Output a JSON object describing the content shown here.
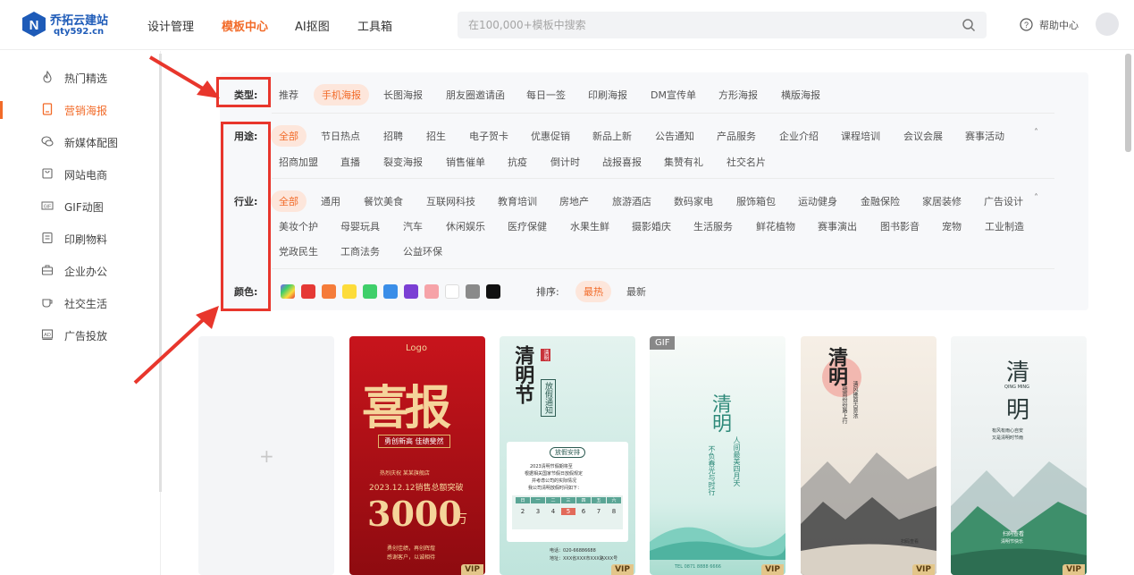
{
  "logo": {
    "name": "乔拓云建站",
    "domain": "qty592.cn"
  },
  "nav": [
    {
      "label": "设计管理",
      "active": false
    },
    {
      "label": "模板中心",
      "active": true
    },
    {
      "label": "AI抠图",
      "active": false
    },
    {
      "label": "工具箱",
      "active": false
    }
  ],
  "search": {
    "placeholder": "在100,000+模板中搜索",
    "icon": "search-icon"
  },
  "help": {
    "label": "帮助中心",
    "icon": "question-icon"
  },
  "sidebar": {
    "items": [
      {
        "label": "热门精选",
        "icon": "flame-icon",
        "active": false
      },
      {
        "label": "营销海报",
        "icon": "poster-icon",
        "active": true
      },
      {
        "label": "新媒体配图",
        "icon": "chat-icon",
        "active": false
      },
      {
        "label": "网站电商",
        "icon": "bag-icon",
        "active": false
      },
      {
        "label": "GIF动图",
        "icon": "gif-icon",
        "active": false
      },
      {
        "label": "印刷物料",
        "icon": "print-icon",
        "active": false
      },
      {
        "label": "企业办公",
        "icon": "briefcase-icon",
        "active": false
      },
      {
        "label": "社交生活",
        "icon": "cup-icon",
        "active": false
      },
      {
        "label": "广告投放",
        "icon": "ad-icon",
        "active": false
      }
    ]
  },
  "filters": {
    "type": {
      "label": "类型:",
      "options": [
        "推荐",
        "手机海报",
        "长图海报",
        "朋友圈邀请函",
        "每日一签",
        "印刷海报",
        "DM宣传单",
        "方形海报",
        "横版海报"
      ],
      "selected": "手机海报"
    },
    "usage": {
      "label": "用途:",
      "row1": [
        "全部",
        "节日热点",
        "招聘",
        "招生",
        "电子贺卡",
        "优惠促销",
        "新品上新",
        "公告通知",
        "产品服务",
        "企业介绍",
        "课程培训",
        "会议会展",
        "赛事活动"
      ],
      "row2": [
        "招商加盟",
        "直播",
        "裂变海报",
        "销售催单",
        "抗疫",
        "倒计时",
        "战报喜报",
        "集赞有礼",
        "社交名片"
      ],
      "selected": "全部",
      "collapse_icon": "chevron-up-icon"
    },
    "industry": {
      "label": "行业:",
      "row1": [
        "全部",
        "通用",
        "餐饮美食",
        "互联网科技",
        "教育培训",
        "房地产",
        "旅游酒店",
        "数码家电",
        "服饰箱包",
        "运动健身",
        "金融保险",
        "家居装修",
        "广告设计"
      ],
      "row2": [
        "美妆个护",
        "母婴玩具",
        "汽车",
        "休闲娱乐",
        "医疗保健",
        "水果生鲜",
        "摄影婚庆",
        "生活服务",
        "鲜花植物",
        "赛事演出",
        "图书影音",
        "宠物",
        "工业制造"
      ],
      "row3": [
        "党政民生",
        "工商法务",
        "公益环保"
      ],
      "selected": "全部",
      "collapse_icon": "chevron-up-icon"
    },
    "color": {
      "label": "颜色:",
      "swatches": [
        "#e8e8ff",
        "#e53935",
        "#f57c3a",
        "#fddc3a",
        "#3fcf6a",
        "#3a8ee8",
        "#7b3fd4",
        "#f6a3a8",
        "#ffffff",
        "#8a8a8a",
        "#111111"
      ]
    },
    "sort": {
      "label": "排序:",
      "options": [
        "最热",
        "最新"
      ],
      "selected": "最热"
    }
  },
  "cards": [
    {
      "kind": "add",
      "icon": "plus-icon"
    },
    {
      "kind": "template",
      "badge": "VIP",
      "logo_text": "Logo",
      "title": "喜报",
      "subtitle": "勇创新高 佳绩斐然",
      "line1": "热烈庆祝 某某旗舰店",
      "line2": "2023.12.12销售总额突破",
      "amount": "3000",
      "unit": "万",
      "foot1": "勇创佳绩，再创辉煌",
      "foot2": "感谢客户，以诚相待"
    },
    {
      "kind": "template",
      "badge": "VIP",
      "title": "清明节",
      "side": "放假通知",
      "seal": "清明",
      "box_title": "放假安排",
      "box_l1": "2023清明节假期将至",
      "box_l2": "根据相关国家节假日放假规定",
      "box_l3": "并考虑公司的实际情况",
      "box_l4": "我公司清明放假时间如下：",
      "weekdays": [
        "日",
        "一",
        "二",
        "三",
        "四",
        "五",
        "六"
      ],
      "days": [
        "2",
        "3",
        "4",
        "5",
        "6",
        "7",
        "8"
      ],
      "contact1": "电话：020-66886688",
      "contact2": "地址：XXX省XXX市XXX路XXX号"
    },
    {
      "kind": "template",
      "badge": "VIP",
      "gif": "GIF",
      "title": "清明",
      "poem1": "人间最美四月天",
      "poem2": "不负春光与时行",
      "contact": "TEL 0871 8888 6666"
    },
    {
      "kind": "template",
      "badge": "VIP",
      "title": "清明",
      "poem1": "清风拂面古意浓",
      "poem2": "细雨纷纷路上行",
      "footer": "扫码查看"
    },
    {
      "kind": "template",
      "badge": "VIP",
      "title": "清",
      "title2": "明",
      "en": "QING MING",
      "poem1": "有风有雨心自安",
      "poem2": "又是清明时节雨",
      "footer1": "扫码查看",
      "footer2": "清明节快乐"
    }
  ]
}
